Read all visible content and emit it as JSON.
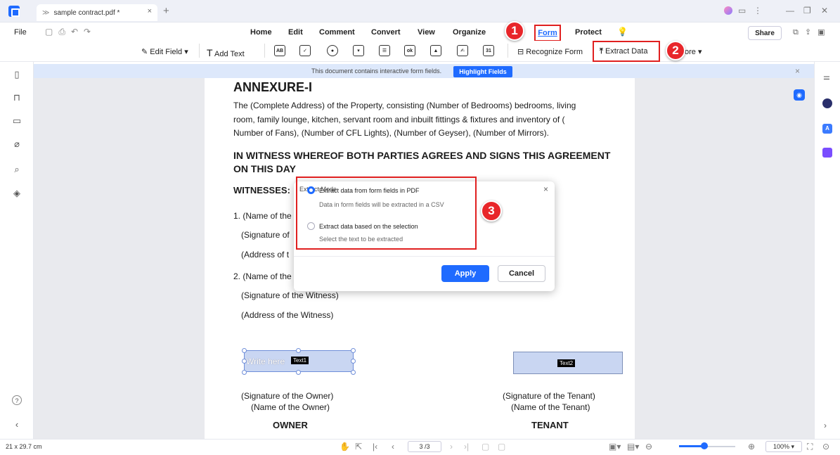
{
  "window": {
    "tab_title": "sample contract.pdf *",
    "tab_close": "×",
    "new_tab": "+",
    "controls": [
      "—",
      "❐",
      "✕"
    ]
  },
  "menu": {
    "file": "File",
    "items": [
      "Home",
      "Edit",
      "Comment",
      "Convert",
      "View",
      "Organize",
      "Form",
      "Protect"
    ],
    "share": "Share"
  },
  "toolbar": {
    "edit_field": "Edit Field",
    "add_text": "Add Text",
    "icons": [
      "AB",
      "✓",
      "●",
      "▾",
      "☰",
      "ok",
      "▲",
      "✍",
      "31"
    ],
    "recognize_form": "Recognize Form",
    "extract_data": "Extract Data",
    "more": "ore"
  },
  "badges": [
    "1",
    "2",
    "3"
  ],
  "notice": {
    "text": "This document contains interactive form fields.",
    "highlight_button": "Highlight Fields"
  },
  "document": {
    "heading": "ANNEXURE-I",
    "paragraph": [
      "The (Complete Address) of the Property, consisting (Number of Bedrooms) bedrooms, living",
      "room, family lounge, kitchen, servant room and inbuilt fittings & fixtures and inventory of (",
      "Number of Fans), (Number of CFL Lights), (Number of Geyser), (Number of Mirrors)."
    ],
    "witness_heading_1": "IN WITNESS WHEREOF BOTH PARTIES AGREES AND SIGNS THIS AGREEMENT",
    "witness_heading_2": "ON THIS DAY",
    "witnesses": "WITNESSES:",
    "w1_name": "1. (Name of the",
    "w1_sig": "(Signature of",
    "w1_addr": "(Address of t",
    "w2_name": "2. (Name of the",
    "w2_sig": "(Signature of the Witness)",
    "w2_addr": "(Address of the Witness)",
    "field1_text": "Write here",
    "field1_tag": "Text1",
    "field2_tag": "Text2",
    "owner_sig": "(Signature of the Owner)",
    "owner_name": "(Name of the Owner)",
    "owner": "OWNER",
    "tenant_sig": "(Signature of the Tenant)",
    "tenant_name": "(Name of the Tenant)",
    "tenant": "TENANT"
  },
  "dialog": {
    "title": "Extract Mode",
    "close": "×",
    "option1_label": "Extract data from form fields in PDF",
    "option1_desc": "Data in form fields will be extracted in a CSV",
    "option2_label": "Extract data based on the selection",
    "option2_desc": "Select the text to be extracted",
    "selected_option": 1,
    "apply": "Apply",
    "cancel": "Cancel"
  },
  "status": {
    "page_size": "21 x 29.7 cm",
    "page_indicator": "3 /3",
    "zoom": "100%",
    "zoom_level": 0.45
  },
  "colors": {
    "accent": "#1f6bff",
    "highlight_red": "#e02020",
    "badge_red": "#e8262a",
    "field_fill": "#c9d6f2"
  }
}
